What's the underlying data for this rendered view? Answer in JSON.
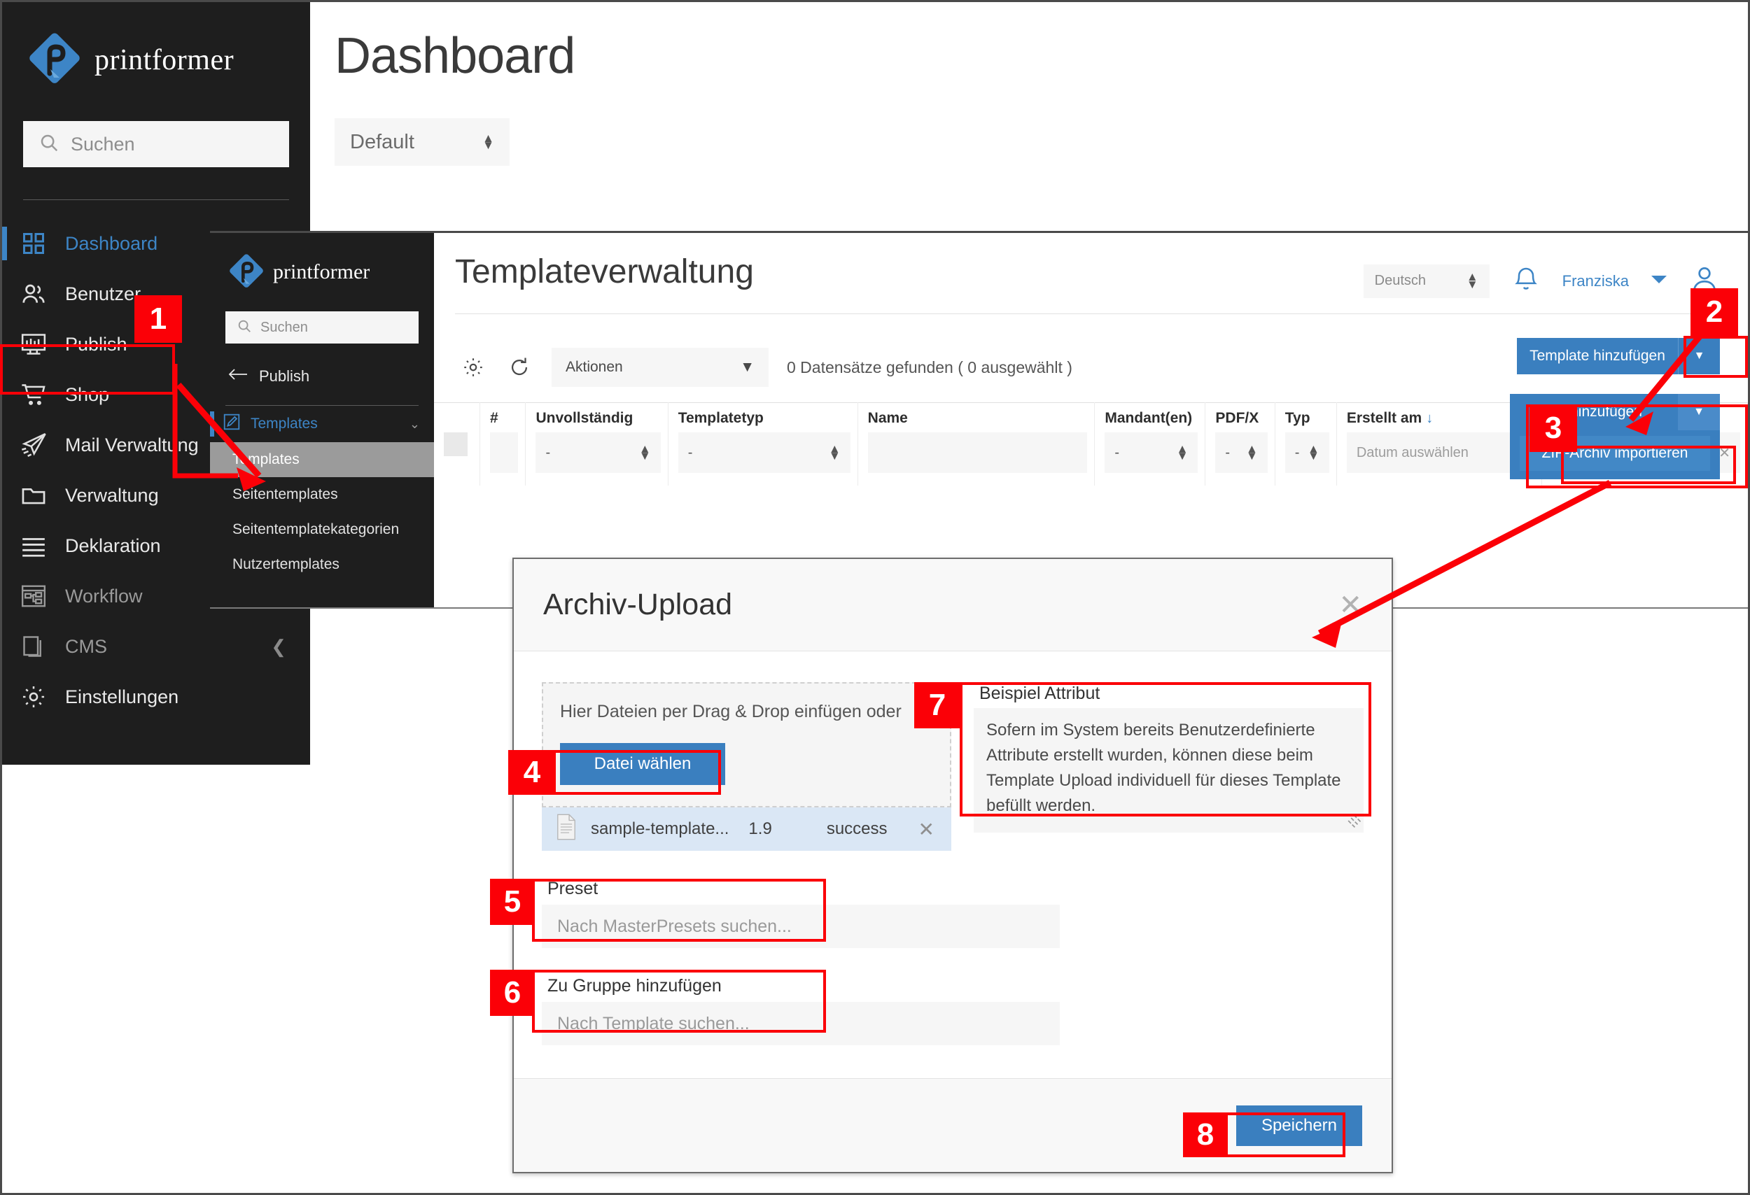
{
  "window1": {
    "brand": "printformer",
    "search_placeholder": "Suchen",
    "title": "Dashboard",
    "default_select": "Default",
    "nav": [
      {
        "label": "Dashboard",
        "icon": "grid-icon",
        "state": "active"
      },
      {
        "label": "Benutzer",
        "icon": "users-icon",
        "state": "normal"
      },
      {
        "label": "Publish",
        "icon": "monitor-icon",
        "state": "normal"
      },
      {
        "label": "Shop",
        "icon": "cart-icon",
        "state": "normal"
      },
      {
        "label": "Mail Verwaltung",
        "icon": "plane-icon",
        "state": "normal"
      },
      {
        "label": "Verwaltung",
        "icon": "folder-icon",
        "state": "normal"
      },
      {
        "label": "Deklaration",
        "icon": "lines-icon",
        "state": "normal"
      },
      {
        "label": "Workflow",
        "icon": "flow-icon",
        "state": "dim"
      },
      {
        "label": "CMS",
        "icon": "pages-icon",
        "state": "dim"
      },
      {
        "label": "Einstellungen",
        "icon": "gear-icon",
        "state": "normal"
      }
    ]
  },
  "window2": {
    "brand": "printformer",
    "search_placeholder": "Suchen",
    "back_label": "Publish",
    "submenu_header": "Templates",
    "submenu": [
      {
        "label": "Templates",
        "selected": true
      },
      {
        "label": "Seitentemplates",
        "selected": false
      },
      {
        "label": "Seitentemplatekategorien",
        "selected": false
      },
      {
        "label": "Nutzertemplates",
        "selected": false
      }
    ],
    "title": "Templateverwaltung",
    "language": "Deutsch",
    "user": "Franziska",
    "add_template_label": "Template hinzufügen",
    "dropdown": {
      "button_label": "ate hinzufügen",
      "item_label": "ZIP-Archiv importieren"
    },
    "toolbar": {
      "actions_label": "Aktionen",
      "records_text": "0 Datensätze gefunden ( 0 ausgewählt )"
    },
    "table": {
      "headers": [
        "",
        "#",
        "Unvollständig",
        "Templatetyp",
        "Name",
        "Mandant(en)",
        "PDF/X",
        "Typ",
        "Erstellt am",
        ""
      ],
      "filter_dash": "-",
      "date_placeholder": "Datum auswählen"
    }
  },
  "modal": {
    "title": "Archiv-Upload",
    "dropzone_text": "Hier Dateien per Drag & Drop einfügen oder",
    "choose_file_label": "Datei wählen",
    "file": {
      "name": "sample-template...",
      "size": "1.9",
      "status": "success"
    },
    "attribute": {
      "label": "Beispiel Attribut",
      "value": "Sofern im System bereits Benutzerdefinierte Attribute erstellt wurden, können diese beim Template Upload individuell für dieses Template befüllt werden."
    },
    "preset": {
      "label": "Preset",
      "placeholder": "Nach MasterPresets suchen..."
    },
    "group": {
      "label": "Zu Gruppe hinzufügen",
      "placeholder": "Nach Template suchen..."
    },
    "save_label": "Speichern"
  },
  "annotations": {
    "step1": "1",
    "step2": "2",
    "step3": "3",
    "step4": "4",
    "step5": "5",
    "step6": "6",
    "step7": "7",
    "step8": "8",
    "color": "#fb0007"
  }
}
